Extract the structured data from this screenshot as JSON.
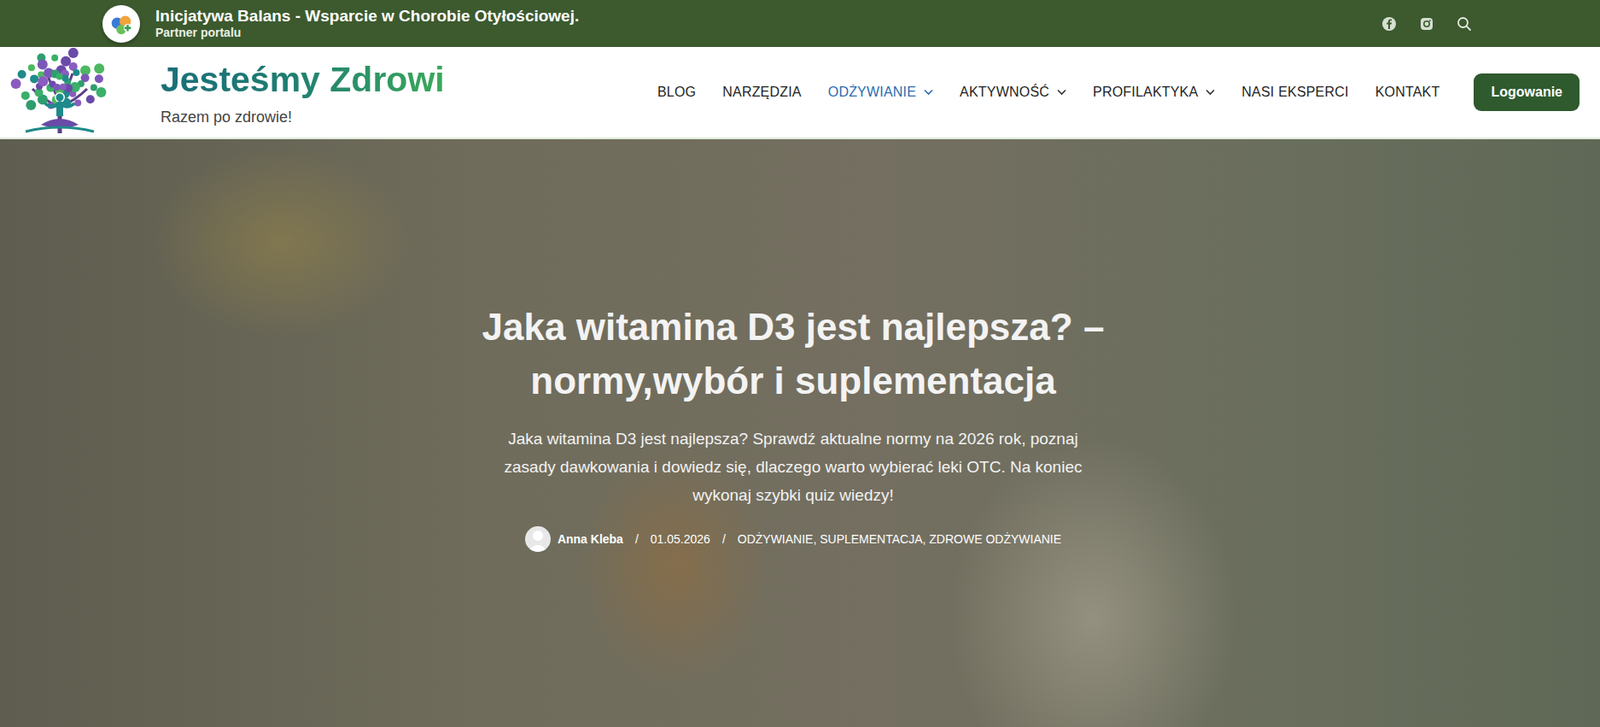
{
  "partner_bar": {
    "title": "Inicjatywa Balans - Wsparcie w Chorobie Otyłościowej.",
    "subtitle": "Partner portalu"
  },
  "site": {
    "name": "Jesteśmy Zdrowi",
    "tagline": "Razem po zdrowie!"
  },
  "nav": [
    {
      "label": "BLOG",
      "selected": false,
      "has_dropdown": false
    },
    {
      "label": "NARZĘDZIA",
      "selected": false,
      "has_dropdown": false
    },
    {
      "label": "ODŻYWIANIE",
      "selected": true,
      "has_dropdown": true
    },
    {
      "label": "AKTYWNOŚĆ",
      "selected": false,
      "has_dropdown": true
    },
    {
      "label": "PROFILAKTYKA",
      "selected": false,
      "has_dropdown": true
    },
    {
      "label": "NASI EKSPERCI",
      "selected": false,
      "has_dropdown": false
    },
    {
      "label": "KONTAKT",
      "selected": false,
      "has_dropdown": false
    }
  ],
  "login_button": "Logowanie",
  "hero": {
    "title_lines": [
      "Jaka witamina D3 jest najlepsza? –",
      "normy,wybór i suplementacja"
    ],
    "description": "Jaka witamina D3 jest najlepsza? Sprawdź aktualne normy na 2026 rok, poznaj zasady dawkowania i dowiedz się, dlaczego warto wybierać leki OTC. Na koniec wykonaj szybki quiz wiedzy!",
    "meta": {
      "author": "Anna Kleba",
      "separator": "/",
      "date": "01.05.2026",
      "categories": "ODŻYWIANIE, SUPLEMENTACJA, ZDROWE ODŻYWIANIE"
    }
  }
}
